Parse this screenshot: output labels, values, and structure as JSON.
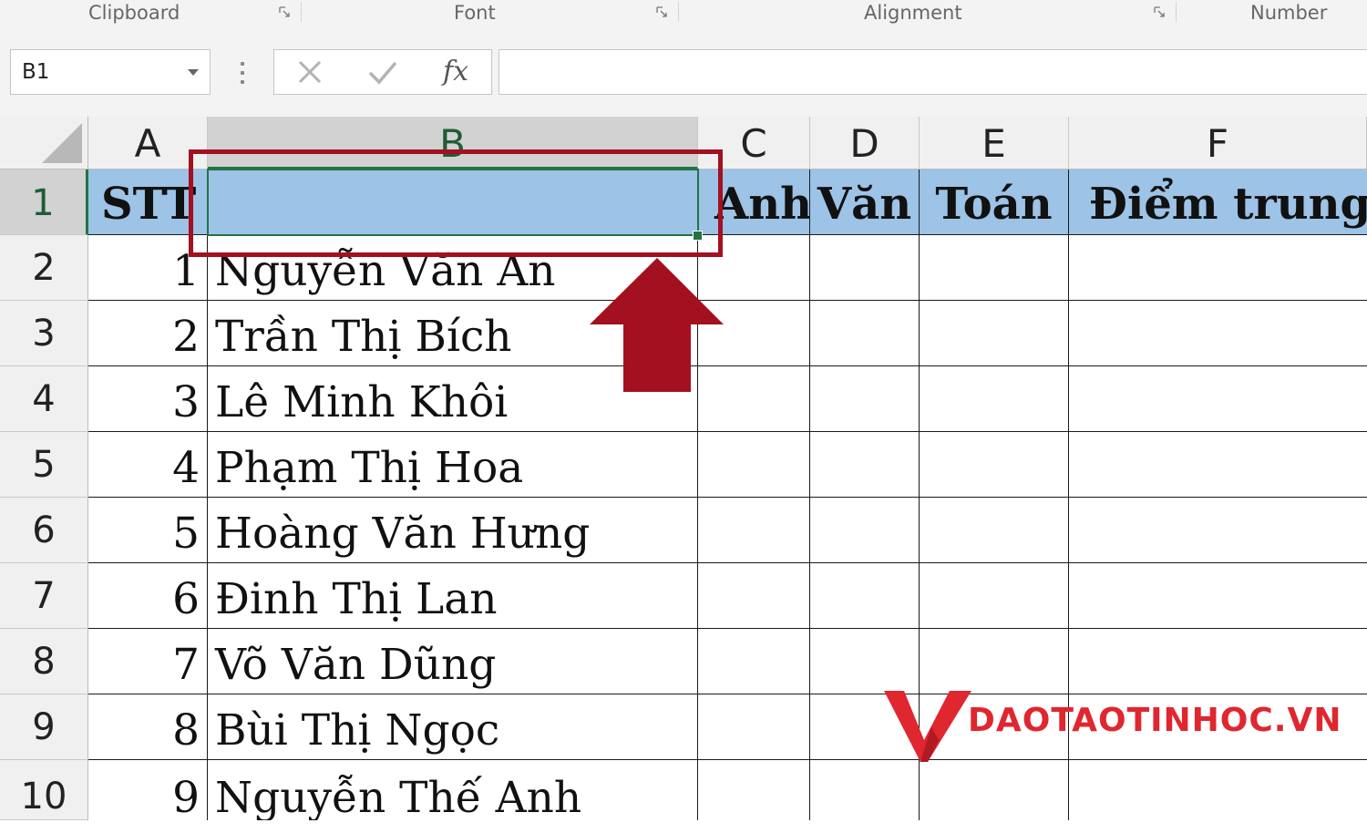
{
  "ribbon": {
    "groups": [
      "Clipboard",
      "Font",
      "Alignment",
      "Number"
    ]
  },
  "formula_bar": {
    "name_box": "B1",
    "cancel_icon": "close-icon",
    "enter_icon": "check-icon",
    "fx_label": "fx",
    "formula_value": ""
  },
  "grid": {
    "columns": [
      "A",
      "B",
      "C",
      "D",
      "E",
      "F"
    ],
    "rows": [
      "1",
      "2",
      "3",
      "4",
      "5",
      "6",
      "7",
      "8",
      "9",
      "10"
    ],
    "header_row": {
      "A": "STT",
      "B": "",
      "C": "Anh",
      "D": "Văn",
      "E": "Toán",
      "F": "Điểm trung bì"
    },
    "data_rows": [
      {
        "stt": "1",
        "name": "Nguyễn Văn An"
      },
      {
        "stt": "2",
        "name": "Trần Thị Bích"
      },
      {
        "stt": "3",
        "name": "Lê Minh Khôi"
      },
      {
        "stt": "4",
        "name": "Phạm Thị Hoa"
      },
      {
        "stt": "5",
        "name": "Hoàng Văn Hưng"
      },
      {
        "stt": "6",
        "name": "Đinh Thị Lan"
      },
      {
        "stt": "7",
        "name": "Võ Văn Dũng"
      },
      {
        "stt": "8",
        "name": "Bùi Thị Ngọc"
      },
      {
        "stt": "9",
        "name": "Nguyễn Thế Anh"
      }
    ],
    "selected_cell": "B1"
  },
  "colors": {
    "header_fill": "#9dc3e6",
    "selection_green": "#217346",
    "annotation_red": "#a31020",
    "logo_red": "#e0262f"
  },
  "logo": {
    "text": "DAOTAOTINHOC.VN"
  }
}
